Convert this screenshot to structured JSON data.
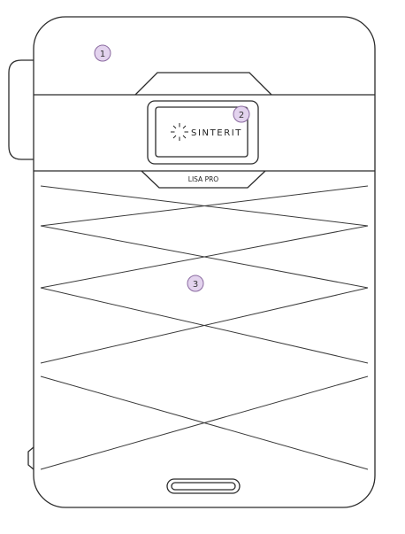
{
  "device": {
    "brand": "SINTERIT",
    "model": "LISA PRO"
  },
  "callouts": [
    {
      "label": "1"
    },
    {
      "label": "2"
    },
    {
      "label": "3"
    }
  ]
}
